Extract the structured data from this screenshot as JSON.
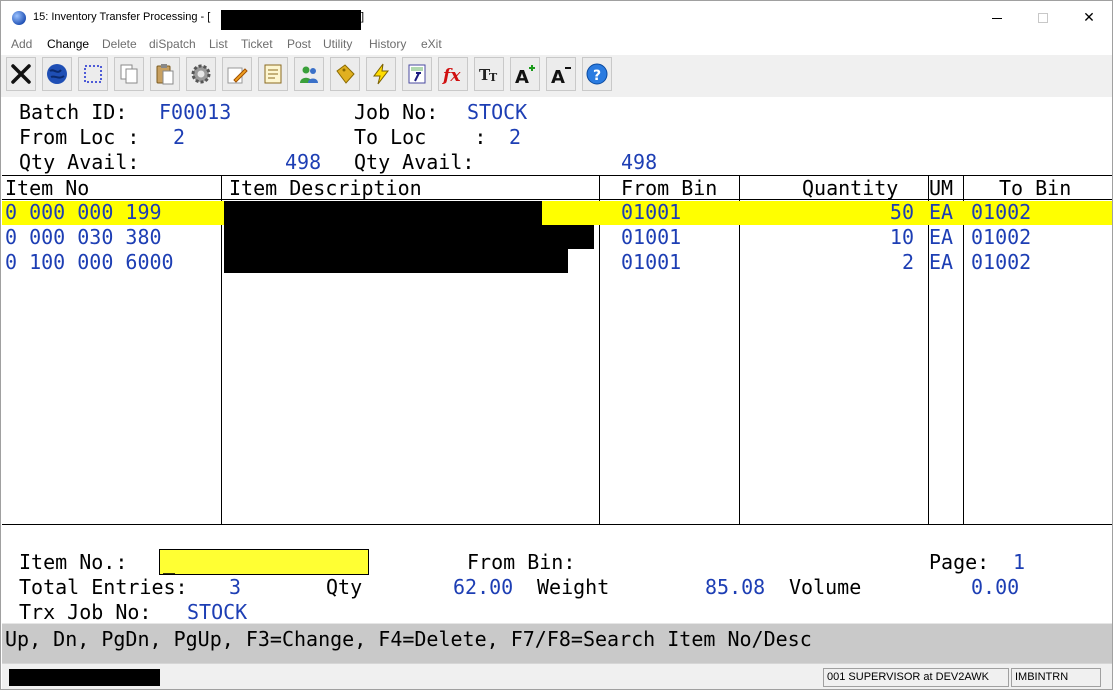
{
  "window": {
    "title": "15: Inventory Transfer Processing - [",
    "title_end": "]",
    "min": "—",
    "max": "□",
    "close": "✕"
  },
  "menu": [
    "Add",
    "Change",
    "Delete",
    "diSpatch",
    "List",
    "Ticket",
    "Post",
    "Utility",
    "History",
    "eXit"
  ],
  "menu_active": "Change",
  "toolbar_icons": [
    "close-x-icon",
    "globe-icon",
    "select-rect-icon",
    "copy-icon",
    "paste-icon",
    "settings-gear-icon",
    "edit-pencil-icon",
    "notepad-icon",
    "users-icon",
    "tag-icon",
    "lightning-icon",
    "calculator-icon",
    "fx-function-icon",
    "text-size-icon",
    "font-increase-icon",
    "font-decrease-icon",
    "help-icon"
  ],
  "header": {
    "batch_label": "Batch ID:",
    "batch_value": "F00013",
    "job_label": "Job No:",
    "job_value": "STOCK",
    "from_loc_label": "From Loc :",
    "from_loc_value": "2",
    "to_loc_label": "To Loc    :",
    "to_loc_value": "2",
    "qty_avail_label": "Qty Avail:",
    "qty_avail_from": "498",
    "qty_avail_label2": "Qty Avail:",
    "qty_avail_to": "498"
  },
  "grid": {
    "columns": [
      "Item No",
      "Item Description",
      "From Bin",
      "Quantity",
      "UM",
      "To Bin"
    ],
    "rows": [
      {
        "item_no": "0 000 000 199",
        "from_bin": "01001",
        "quantity": "50",
        "um": "EA",
        "to_bin": "01002"
      },
      {
        "item_no": "0 000 030 380",
        "from_bin": "01001",
        "quantity": "10",
        "um": "EA",
        "to_bin": "01002"
      },
      {
        "item_no": "0 100 000 6000",
        "from_bin": "01001",
        "quantity": "2",
        "um": "EA",
        "to_bin": "01002"
      }
    ]
  },
  "footer": {
    "item_no_label": "Item No.:",
    "item_no_cursor": "_",
    "from_bin_label": "From Bin:",
    "page_label": "Page:",
    "page_value": "1",
    "total_entries_label": "Total Entries:",
    "total_entries_value": "3",
    "qty_label": "Qty",
    "qty_value": "62.00",
    "weight_label": "Weight",
    "weight_value": "85.08",
    "volume_label": "Volume",
    "volume_value": "0.00",
    "trx_job_label": "Trx Job No:",
    "trx_job_value": "STOCK"
  },
  "fkeys": "Up, Dn, PgDn, PgUp, F3=Change, F4=Delete, F7/F8=Search Item No/Desc",
  "status": {
    "user": "001 SUPERVISOR at DEV2AWK",
    "program": "IMBINTRN"
  },
  "colors": {
    "value_blue": "#1d3eb4",
    "highlight_yellow": "#ffff00",
    "fkey_gray": "#c9c9c9"
  }
}
